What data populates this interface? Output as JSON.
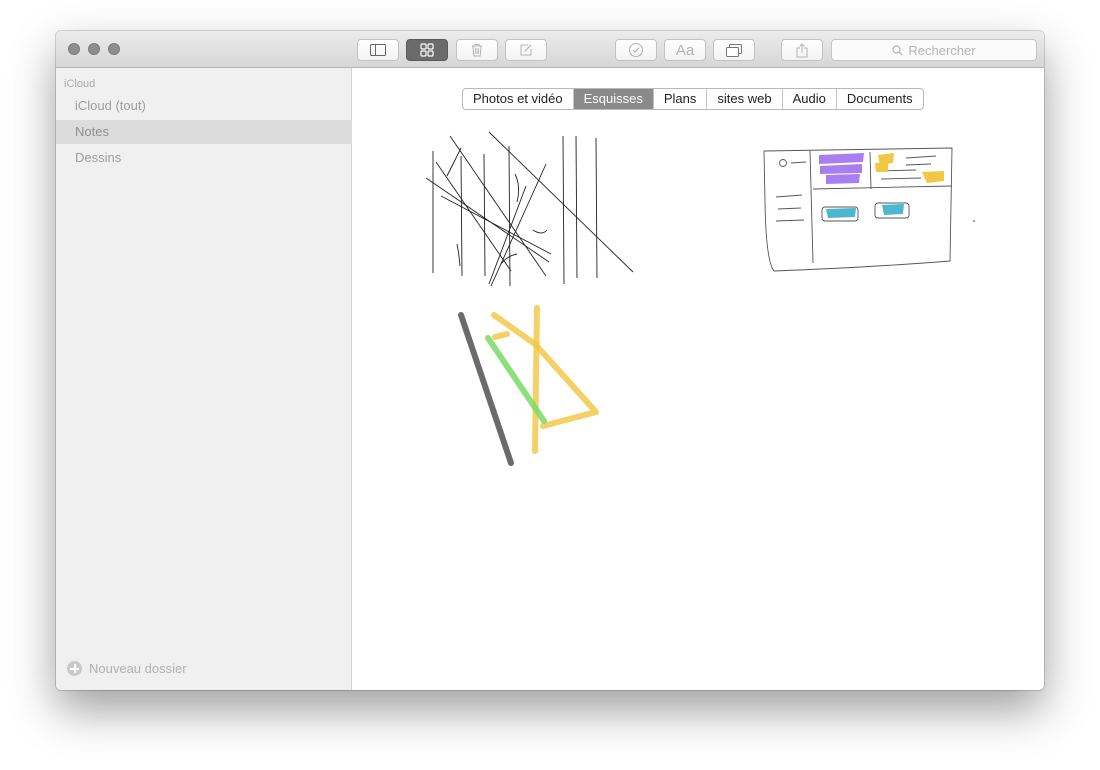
{
  "toolbar": {
    "buttons": [
      {
        "id": "sidebar-toggle",
        "icon": "sidebar-icon"
      },
      {
        "id": "attachments-browser",
        "icon": "grid-icon",
        "active": true
      },
      {
        "id": "delete",
        "icon": "trash-icon"
      },
      {
        "id": "new-note",
        "icon": "compose-icon"
      },
      {
        "id": "checklist",
        "icon": "checkmark-circle-icon"
      },
      {
        "id": "format",
        "icon": "text-format-icon",
        "label": "Aa"
      },
      {
        "id": "table",
        "icon": "table-icon"
      },
      {
        "id": "share",
        "icon": "share-icon"
      }
    ],
    "search_placeholder": "Rechercher"
  },
  "sidebar": {
    "header": "iCloud",
    "items": [
      {
        "label": "iCloud (tout)",
        "selected": false
      },
      {
        "label": "Notes",
        "selected": true
      },
      {
        "label": "Dessins",
        "selected": false
      }
    ],
    "new_folder_label": "Nouveau dossier"
  },
  "tabs": [
    {
      "label": "Photos et vidéo",
      "active": false
    },
    {
      "label": "Esquisses",
      "active": true
    },
    {
      "label": "Plans",
      "active": false
    },
    {
      "label": "sites web",
      "active": false
    },
    {
      "label": "Audio",
      "active": false
    },
    {
      "label": "Documents",
      "active": false
    }
  ],
  "colors": {
    "segment_active": "#8a8a8a",
    "sketch_purple": "#a97ff0",
    "sketch_yellow": "#f2c744",
    "sketch_teal": "#4db7cf",
    "sketch_green": "#7ddc6a",
    "sketch_gray": "#6b6b6b"
  }
}
